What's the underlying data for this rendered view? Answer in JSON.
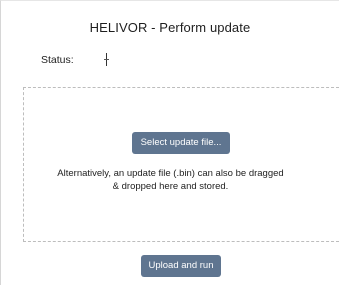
{
  "page": {
    "title": "HELIVOR - Perform update"
  },
  "status": {
    "label": "Status:",
    "value": ""
  },
  "dropzone": {
    "select_button_label": "Select update file...",
    "alt_text_line1": "Alternatively, an update file (.bin) can also be dragged",
    "alt_text_line2": "& dropped here and stored."
  },
  "actions": {
    "upload_button_label": "Upload and run"
  },
  "colors": {
    "button_bg": "#5f7590",
    "button_text": "#ffffff",
    "dropzone_border": "#bdbdbd"
  }
}
